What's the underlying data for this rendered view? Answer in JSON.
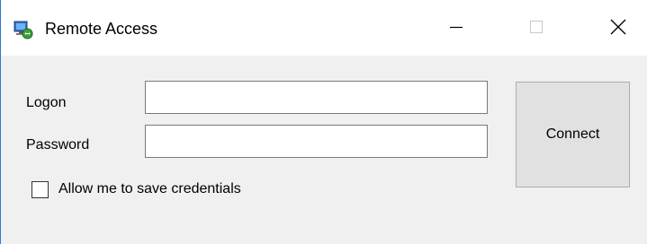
{
  "window": {
    "title": "Remote Access",
    "icon": "remote-access-app-icon",
    "accent_color": "#2b79d8"
  },
  "caption_buttons": {
    "minimize_icon": "minimize-icon",
    "maximize_icon": "maximize-icon",
    "close_icon": "close-icon"
  },
  "form": {
    "logon_label": "Logon",
    "logon_value": "",
    "password_label": "Password",
    "password_value": "",
    "save_credentials_label": "Allow me to save credentials",
    "save_credentials_checked": false,
    "connect_label": "Connect"
  }
}
